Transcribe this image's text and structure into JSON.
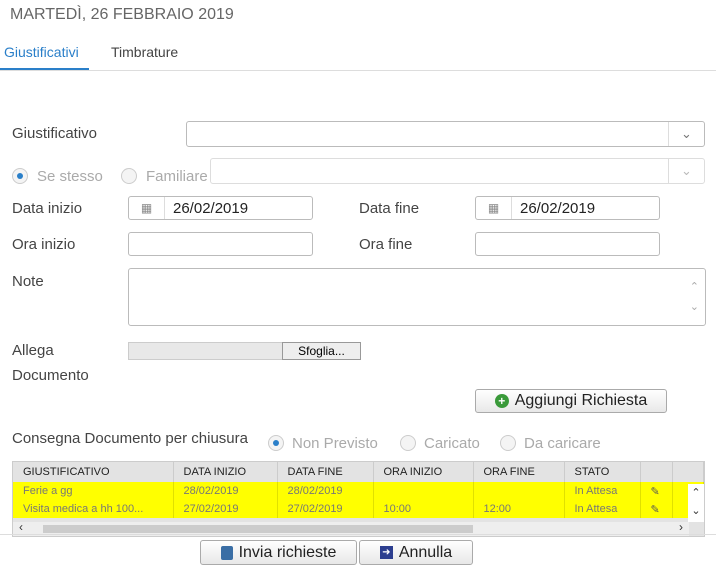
{
  "header": {
    "date": "MARTEDÌ, 26 FEBBRAIO 2019"
  },
  "tabs": [
    {
      "label": "Giustificativi"
    },
    {
      "label": "Timbrature"
    }
  ],
  "form": {
    "giustificativo_label": "Giustificativo",
    "se_stesso": "Se stesso",
    "familiare": "Familiare",
    "data_inizio_label": "Data inizio",
    "data_inizio": "26/02/2019",
    "data_fine_label": "Data fine",
    "data_fine": "26/02/2019",
    "ora_inizio_label": "Ora inizio",
    "ora_fine_label": "Ora fine",
    "note_label": "Note",
    "allega_label": "Allega",
    "documento_label": "Documento",
    "sfoglia": "Sfoglia...",
    "aggiungi": "Aggiungi Richiesta",
    "consegna_label": "Consegna Documento per chiusura",
    "non_previsto": "Non Previsto",
    "caricato": "Caricato",
    "da_caricare": "Da caricare"
  },
  "table": {
    "headers": [
      "GIUSTIFICATIVO",
      "DATA INIZIO",
      "DATA FINE",
      "ORA INIZIO",
      "ORA FINE",
      "STATO"
    ],
    "rows": [
      [
        "Ferie a gg",
        "28/02/2019",
        "28/02/2019",
        "",
        "",
        "In Attesa"
      ],
      [
        "Visita medica a hh 100...",
        "27/02/2019",
        "27/02/2019",
        "10:00",
        "12:00",
        "In Attesa"
      ]
    ]
  },
  "footer": {
    "invia": "Invia richieste",
    "annulla": "Annulla"
  }
}
